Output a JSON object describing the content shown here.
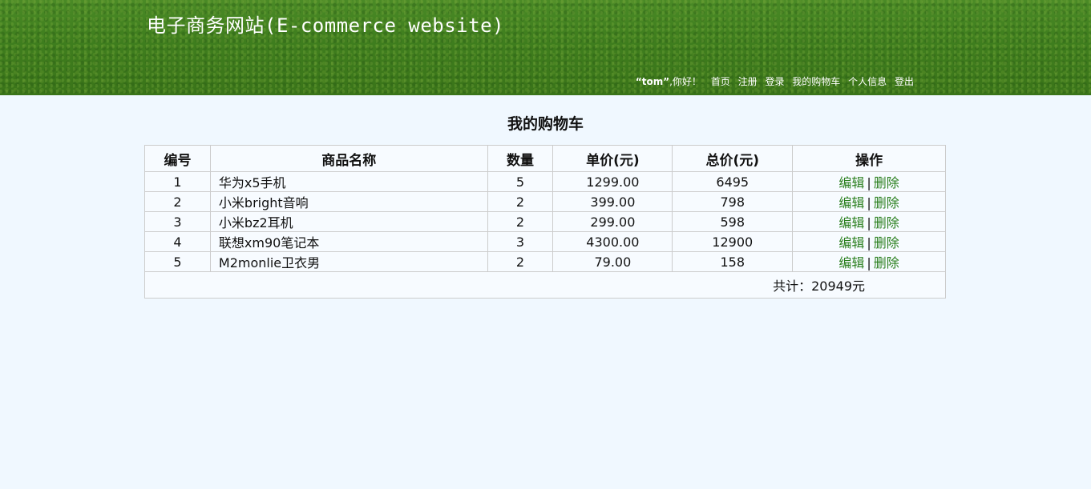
{
  "header": {
    "site_title": "电子商务网站(E-commerce website)",
    "greeting_user": "“tom”",
    "greeting_suffix": ",你好！",
    "nav": [
      "首页",
      "注册",
      "登录",
      "我的购物车",
      "个人信息",
      "登出"
    ]
  },
  "page_title": "我的购物车",
  "table": {
    "headers": [
      "编号",
      "商品名称",
      "数量",
      "单价(元)",
      "总价(元)",
      "操作"
    ],
    "rows": [
      {
        "id": "1",
        "name": "华为x5手机",
        "qty": "5",
        "unit_price": "1299.00",
        "total": "6495"
      },
      {
        "id": "2",
        "name": "小米bright音响",
        "qty": "2",
        "unit_price": "399.00",
        "total": "798"
      },
      {
        "id": "3",
        "name": "小米bz2耳机",
        "qty": "2",
        "unit_price": "299.00",
        "total": "598"
      },
      {
        "id": "4",
        "name": "联想xm90笔记本",
        "qty": "3",
        "unit_price": "4300.00",
        "total": "12900"
      },
      {
        "id": "5",
        "name": "M2monlie卫衣男",
        "qty": "2",
        "unit_price": "79.00",
        "total": "158"
      }
    ],
    "edit_label": "编辑",
    "delete_label": "删除",
    "separator": "|",
    "grand_total": "共计：20949元"
  },
  "colors": {
    "header_green": "#3f7e1e",
    "page_bg": "#f0f8ff",
    "link_green": "#2a7f1e"
  }
}
